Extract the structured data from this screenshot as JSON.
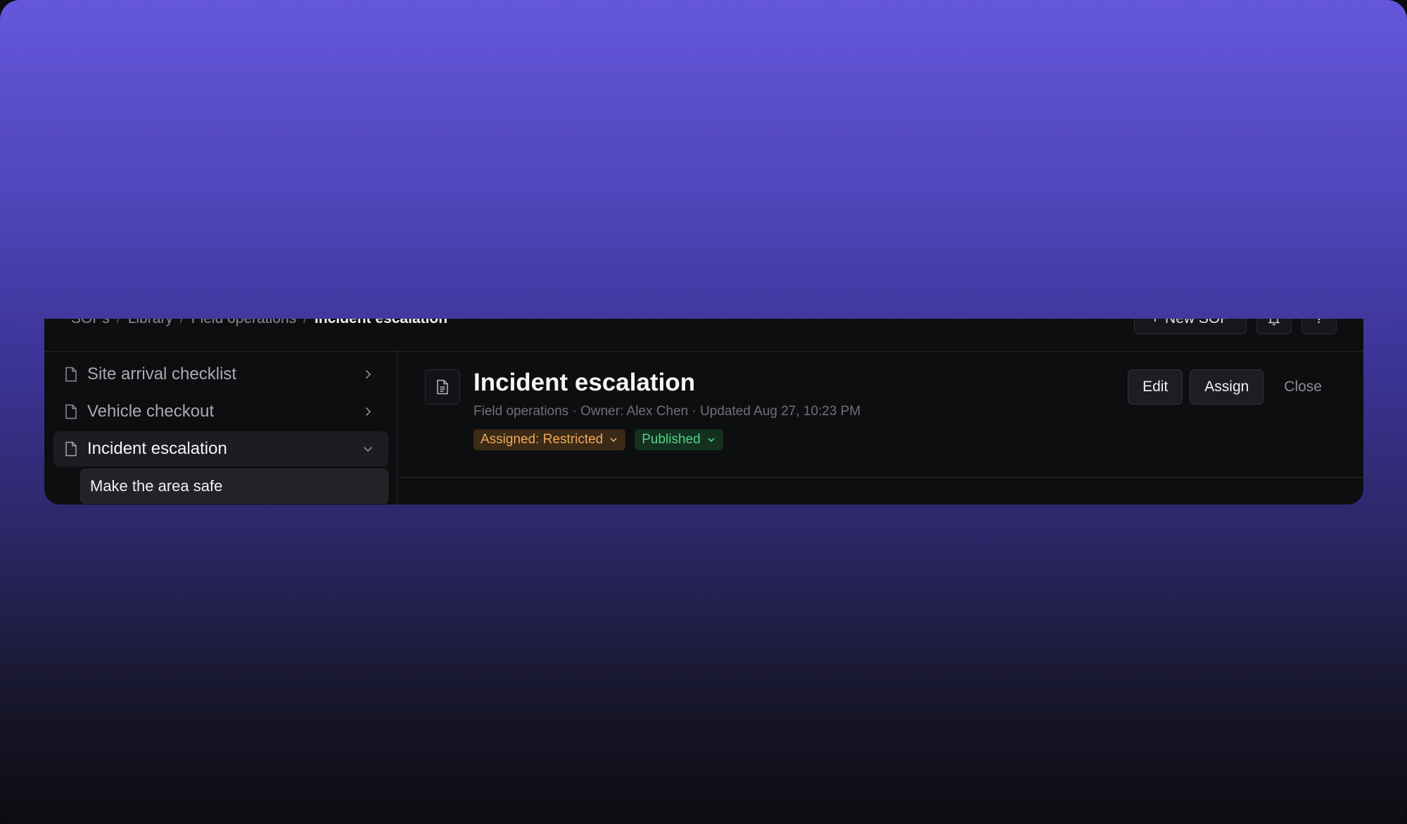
{
  "breadcrumb": {
    "items": [
      "SOPs",
      "Library",
      "Field operations"
    ],
    "separator": "/",
    "current": "Incident escalation"
  },
  "topbar": {
    "new_sop_label": "New SOP",
    "new_sop_icon": "+",
    "bell_icon": "bell-icon",
    "help_label": "?"
  },
  "sidebar": {
    "items": [
      {
        "label": "Site arrival checklist",
        "icon": "document-icon",
        "expanded": false
      },
      {
        "label": "Vehicle checkout",
        "icon": "document-icon",
        "expanded": false
      },
      {
        "label": "Incident escalation",
        "icon": "document-icon",
        "expanded": true
      }
    ],
    "sub_items": [
      "Make the area safe"
    ]
  },
  "document": {
    "title": "Incident escalation",
    "meta": "Field operations · Owner: Alex Chen · Updated Aug 27, 10:23 PM",
    "badges": {
      "assigned": "Assigned: Restricted",
      "status": "Published"
    }
  },
  "actions": {
    "edit_label": "Edit",
    "assign_label": "Assign",
    "close_label": "Close"
  },
  "colors": {
    "assigned_badge_text": "#f0a85a",
    "published_badge_text": "#52d48a"
  }
}
